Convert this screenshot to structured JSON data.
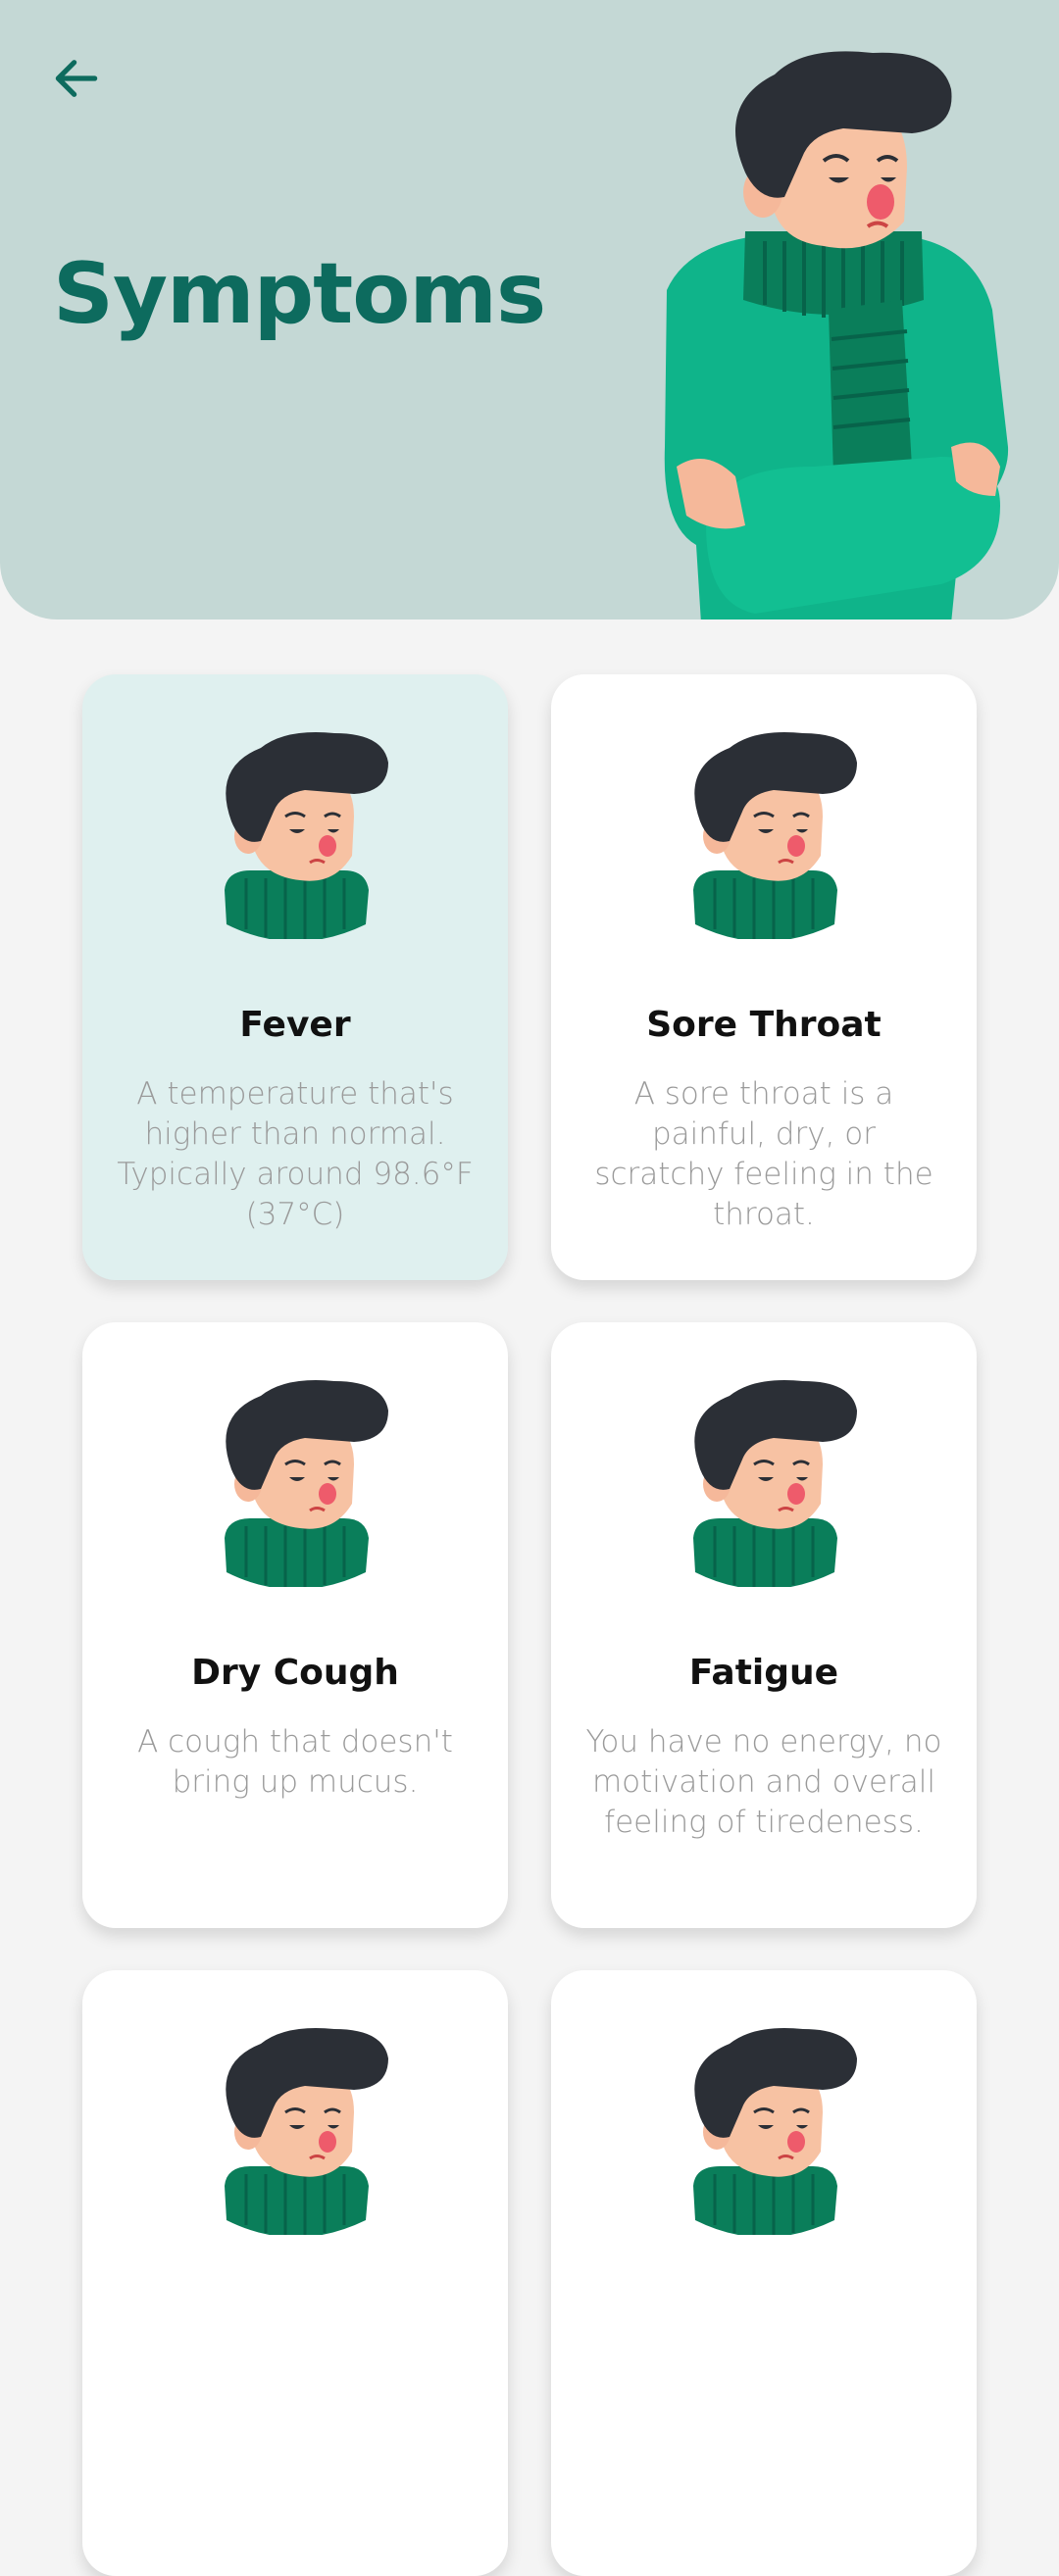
{
  "header": {
    "title": "Symptoms",
    "back_icon": "arrow-left-icon",
    "colors": {
      "background": "#c4d8d5",
      "title": "#0d6b5e"
    }
  },
  "symptoms": [
    {
      "name": "Fever",
      "description": "A temperature that's higher than normal. Typically around 98.6°F (37°C)",
      "active": true
    },
    {
      "name": "Sore Throat",
      "description": "A sore throat is a painful, dry, or scratchy feeling in the throat.",
      "active": false
    },
    {
      "name": "Dry Cough",
      "description": "A cough that doesn't bring up mucus.",
      "active": false
    },
    {
      "name": "Fatigue",
      "description": "You have no energy, no motivation and overall feeling of tiredeness.",
      "active": false
    },
    {
      "name": "",
      "description": "",
      "active": false
    },
    {
      "name": "",
      "description": "",
      "active": false
    }
  ]
}
